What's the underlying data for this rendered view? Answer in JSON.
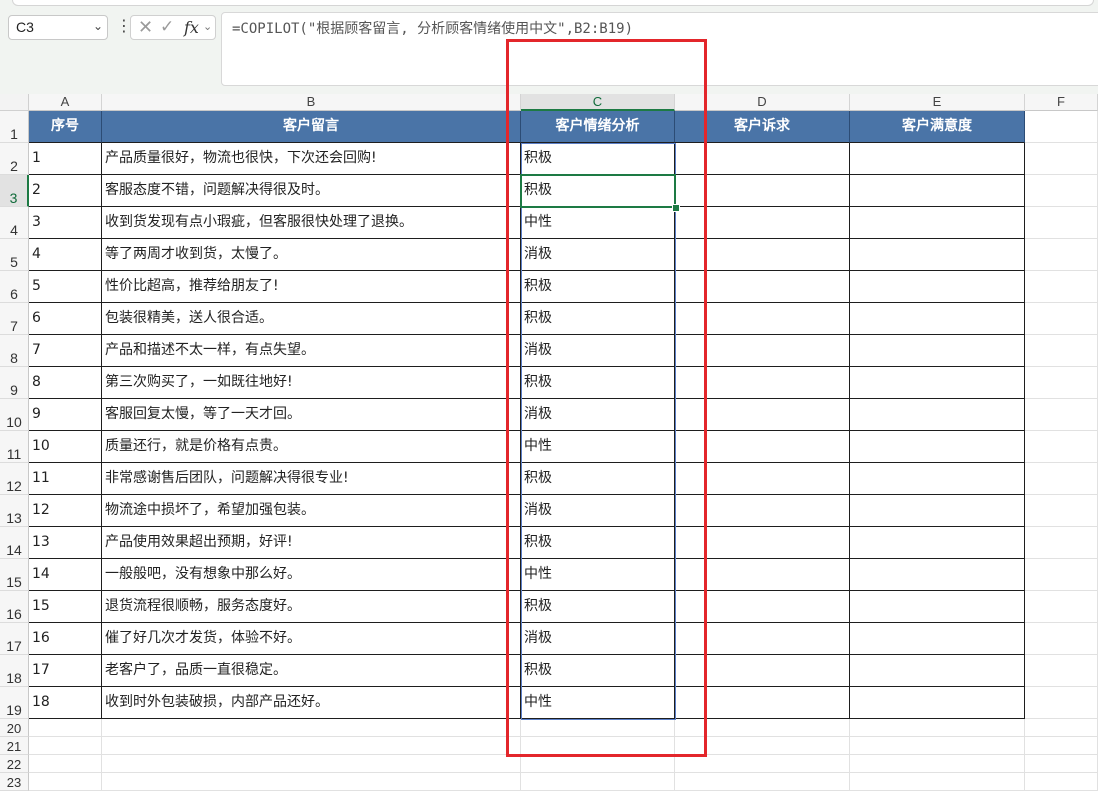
{
  "namebox": {
    "value": "C3"
  },
  "formula": {
    "text": "=COPILOT(\"根据顾客留言, 分析顾客情绪使用中文\",B2:B19)"
  },
  "columns": [
    "A",
    "B",
    "C",
    "D",
    "E",
    "F"
  ],
  "rows": [
    "1",
    "2",
    "3",
    "4",
    "5",
    "6",
    "7",
    "8",
    "9",
    "10",
    "11",
    "12",
    "13",
    "14",
    "15",
    "16",
    "17",
    "18",
    "19",
    "20",
    "21",
    "22",
    "23"
  ],
  "table": {
    "headers": [
      "序号",
      "客户留言",
      "客户情绪分析",
      "客户诉求",
      "客户满意度"
    ],
    "records": [
      {
        "id": "1",
        "comment": "产品质量很好，物流也很快，下次还会回购!",
        "sentiment": "积极"
      },
      {
        "id": "2",
        "comment": "客服态度不错，问题解决得很及时。",
        "sentiment": "积极"
      },
      {
        "id": "3",
        "comment": "收到货发现有点小瑕疵，但客服很快处理了退换。",
        "sentiment": "中性"
      },
      {
        "id": "4",
        "comment": "等了两周才收到货，太慢了。",
        "sentiment": "消极"
      },
      {
        "id": "5",
        "comment": "性价比超高，推荐给朋友了!",
        "sentiment": "积极"
      },
      {
        "id": "6",
        "comment": "包装很精美，送人很合适。",
        "sentiment": "积极"
      },
      {
        "id": "7",
        "comment": "产品和描述不太一样，有点失望。",
        "sentiment": "消极"
      },
      {
        "id": "8",
        "comment": "第三次购买了，一如既往地好!",
        "sentiment": "积极"
      },
      {
        "id": "9",
        "comment": "客服回复太慢，等了一天才回。",
        "sentiment": "消极"
      },
      {
        "id": "10",
        "comment": "质量还行，就是价格有点贵。",
        "sentiment": "中性"
      },
      {
        "id": "11",
        "comment": "非常感谢售后团队，问题解决得很专业!",
        "sentiment": "积极"
      },
      {
        "id": "12",
        "comment": "物流途中损坏了，希望加强包装。",
        "sentiment": "消极"
      },
      {
        "id": "13",
        "comment": "产品使用效果超出预期，好评!",
        "sentiment": "积极"
      },
      {
        "id": "14",
        "comment": "一般般吧，没有想象中那么好。",
        "sentiment": "中性"
      },
      {
        "id": "15",
        "comment": "退货流程很顺畅，服务态度好。",
        "sentiment": "积极"
      },
      {
        "id": "16",
        "comment": "催了好几次才发货，体验不好。",
        "sentiment": "消极"
      },
      {
        "id": "17",
        "comment": "老客户了，品质一直很稳定。",
        "sentiment": "积极"
      },
      {
        "id": "18",
        "comment": "收到时外包装破损，内部产品还好。",
        "sentiment": "中性"
      }
    ]
  },
  "colors": {
    "header_fill": "#4a74a7",
    "selection": "#1d7a44",
    "highlight_box": "#e3262b"
  },
  "icons": {
    "dropdown": "chevron-down-icon",
    "more": "more-vertical-icon",
    "cancel": "cancel-icon",
    "confirm": "check-icon",
    "function": "fx-icon"
  }
}
